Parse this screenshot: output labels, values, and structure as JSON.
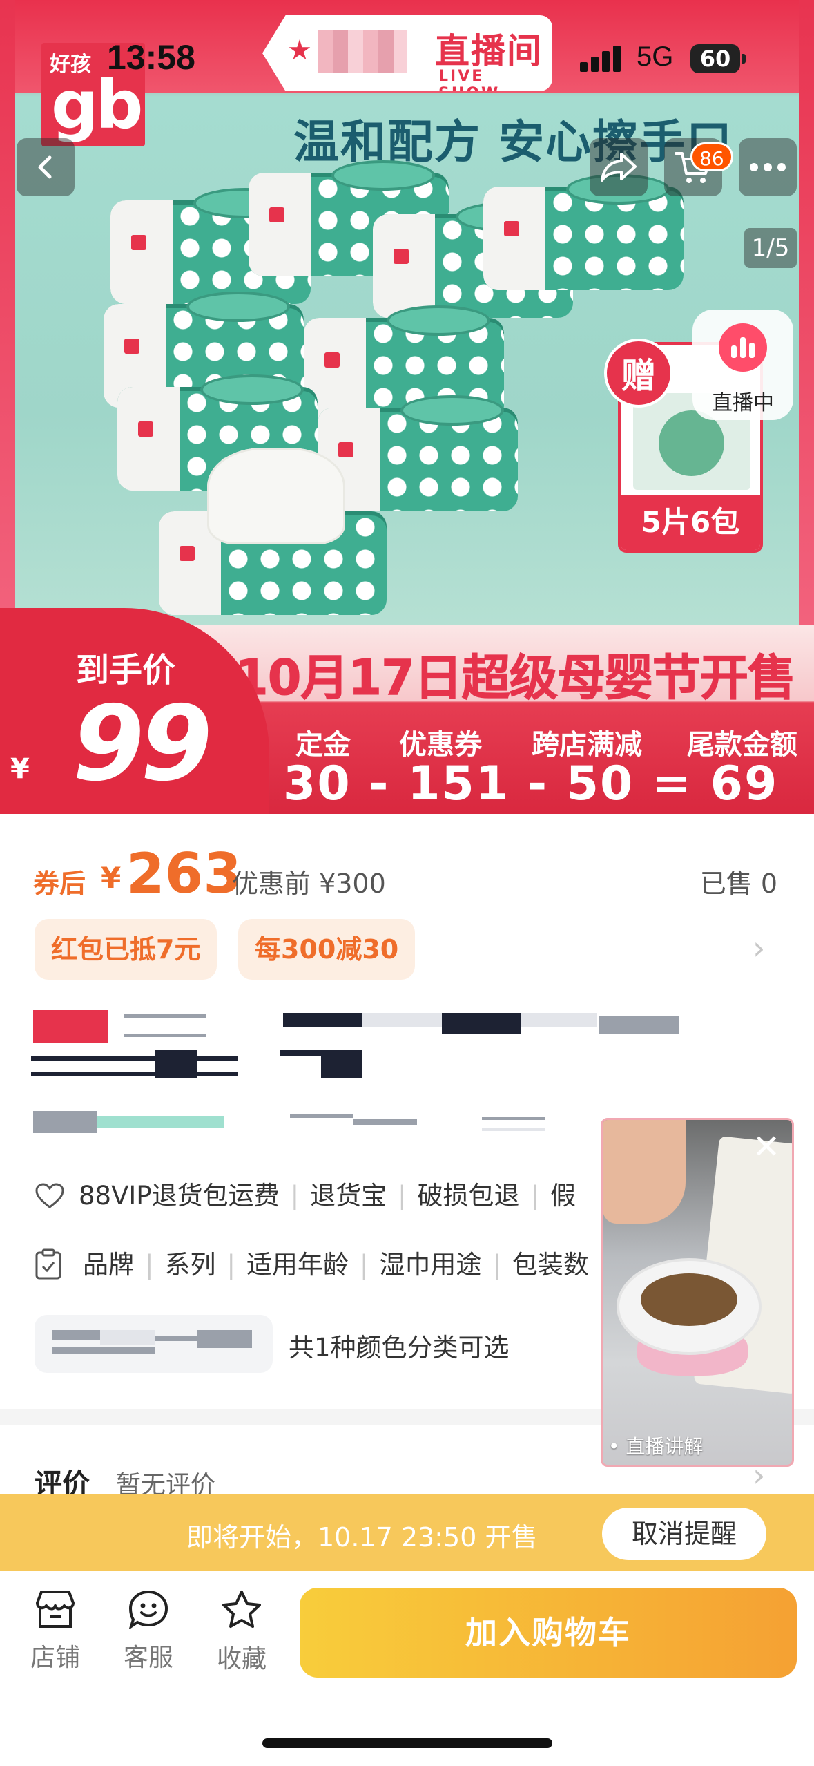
{
  "status_bar": {
    "time": "13:58",
    "network": "5G",
    "battery": "60"
  },
  "hero": {
    "brand_small": "好孩",
    "brand_logo": "gb",
    "live_badge_zh": "直播间",
    "live_badge_en": "LIVE SHOW",
    "slogan": "温和配方 安心擦手口",
    "gift_mark": "赠",
    "gift_label": "5片6包",
    "cart_count": "86",
    "page_indicator": "1/5",
    "live_now": "直播中",
    "banner_title": "10月17日超级母婴节开售",
    "final_price_label": "到手价",
    "final_price": "99",
    "final_price_currency": "¥",
    "formula_labels": [
      "定金",
      "优惠券",
      "跨店满减",
      "尾款金额"
    ],
    "formula": "30 - 151 - 50 = 69"
  },
  "nav": {
    "back_icon": "chevron-left-icon",
    "share_icon": "share-icon",
    "cart_icon": "cart-icon",
    "more_icon": "more-icon"
  },
  "price": {
    "after_coupon_label": "券后",
    "currency": "¥",
    "value": "263",
    "original": "优惠前 ¥300",
    "sold": "已售 0"
  },
  "promo_tags": [
    "红包已抵7元",
    "每300减30"
  ],
  "services": [
    "88VIP退货包运费",
    "退货宝",
    "破损包退",
    "假"
  ],
  "params": [
    "品牌",
    "系列",
    "适用年龄",
    "湿巾用途",
    "包装数"
  ],
  "style_select": {
    "text": "共1种颜色分类可选"
  },
  "review": {
    "title": "评价",
    "subtitle": "暂无评价"
  },
  "video": {
    "caption": "• 直播讲解"
  },
  "reminder": {
    "text": "即将开始，10.17 23:50 开售",
    "button": "取消提醒"
  },
  "toolbar": {
    "items": [
      {
        "label": "店铺",
        "icon": "store-icon"
      },
      {
        "label": "客服",
        "icon": "chat-icon"
      },
      {
        "label": "收藏",
        "icon": "star-icon"
      }
    ],
    "add_cart": "加入购物车"
  },
  "colors": {
    "accent": "#ef6d2a",
    "brand_red": "#e6334c",
    "cart_button": "#f5a133",
    "reminder_bar": "#f7c85b"
  }
}
